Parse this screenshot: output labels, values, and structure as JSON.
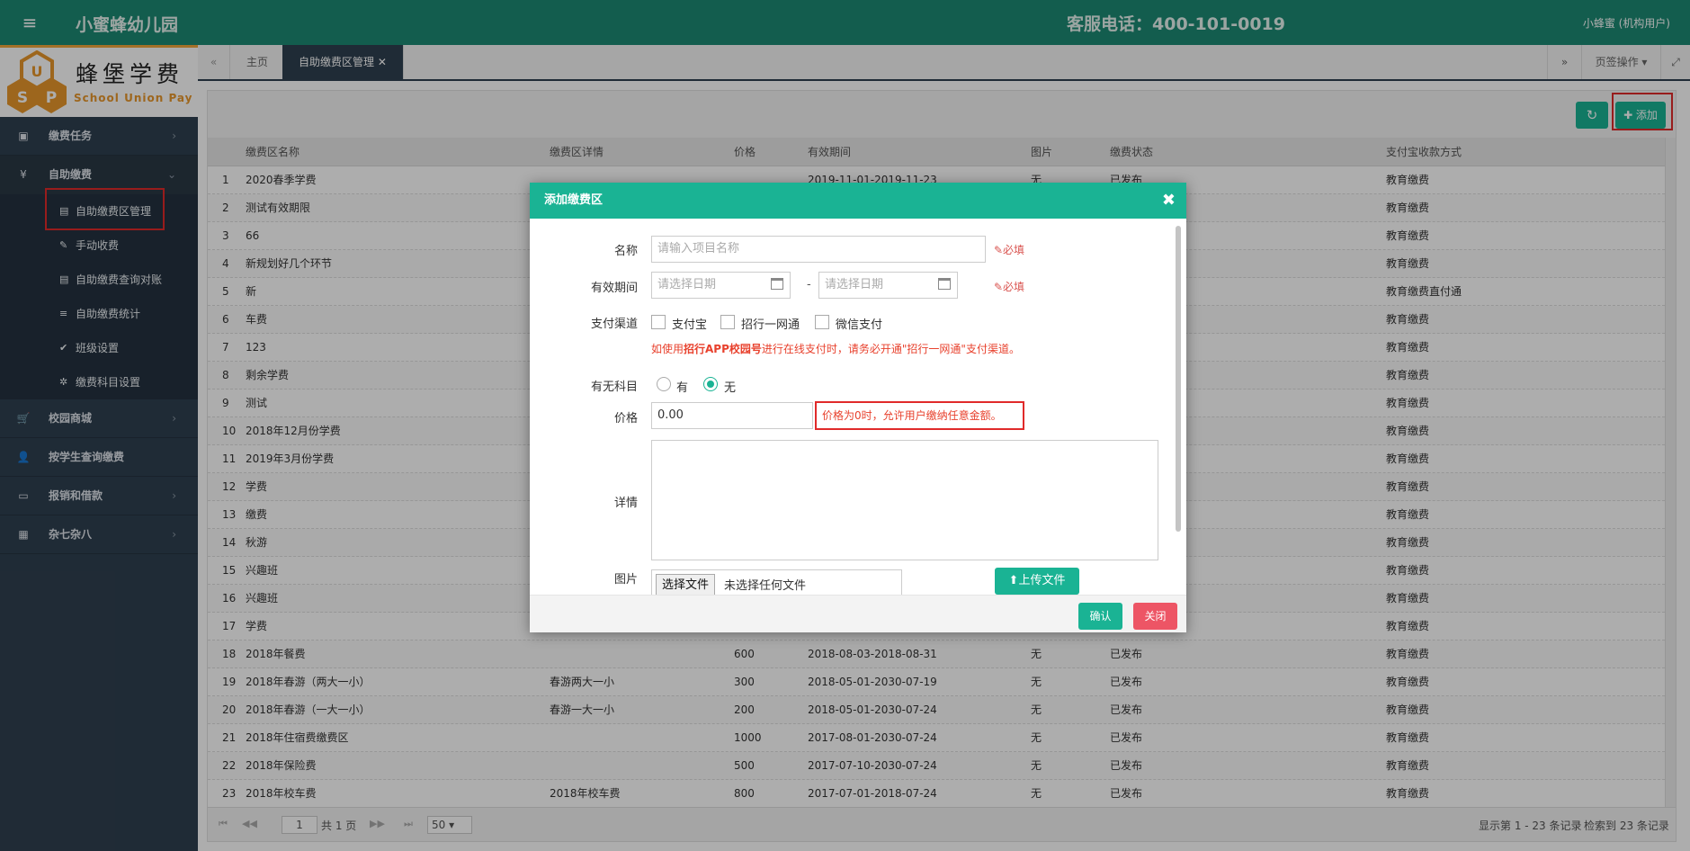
{
  "header": {
    "menu_icon": "≡",
    "app_title": "小蜜蜂幼儿园",
    "hotline": "客服电话：400-101-0019",
    "user": "小蜂蜜 (机构用户)",
    "bg_color": "#1c8a74"
  },
  "logo": {
    "brand": "蜂堡学费",
    "brand_en": "School Union Pay",
    "mark_letters": [
      "U",
      "S",
      "P"
    ]
  },
  "sidebar": {
    "items": [
      {
        "label": "缴费任务",
        "icon": "money-icon",
        "glyph": "▣",
        "arrow": "›"
      },
      {
        "label": "自助缴费",
        "icon": "yen-icon",
        "glyph": "¥",
        "arrow": "⌄"
      },
      {
        "label": "校园商城",
        "icon": "cart-icon",
        "glyph": "🛒",
        "arrow": "›"
      },
      {
        "label": "按学生查询缴费",
        "icon": "user-icon",
        "glyph": "👤",
        "arrow": ""
      },
      {
        "label": "报销和借款",
        "icon": "card-icon",
        "glyph": "▭",
        "arrow": "›"
      },
      {
        "label": "杂七杂八",
        "icon": "grid-icon",
        "glyph": "▦",
        "arrow": "›"
      }
    ],
    "sub_items": [
      {
        "label": "自助缴费区管理",
        "glyph": "▤"
      },
      {
        "label": "手动收费",
        "glyph": "✎"
      },
      {
        "label": "自助缴费查询对账",
        "glyph": "▤"
      },
      {
        "label": "自助缴费统计",
        "glyph": "≡"
      },
      {
        "label": "班级设置",
        "glyph": "✔"
      },
      {
        "label": "缴费科目设置",
        "glyph": "✲"
      }
    ]
  },
  "tabs": {
    "back": "«",
    "home": "主页",
    "active": "自助缴费区管理 ✕",
    "forward": "»",
    "page_ops": "页签操作 ▾",
    "fullscreen": "⤢"
  },
  "toolbar": {
    "refresh": "↻",
    "add": "✚ 添加"
  },
  "table": {
    "headers": [
      "缴费区名称",
      "缴费区详情",
      "价格",
      "有效期间",
      "图片",
      "缴费状态",
      "支付宝收款方式"
    ],
    "rows": [
      [
        "1",
        "2020春季学费",
        "",
        "",
        "2019-11-01-2019-11-23",
        "无",
        "已发布",
        "教育缴费"
      ],
      [
        "2",
        "测试有效期限",
        "",
        "",
        "",
        "",
        "",
        "教育缴费"
      ],
      [
        "3",
        "66",
        "",
        "",
        "",
        "",
        "",
        "教育缴费"
      ],
      [
        "4",
        "新规划好几个环节",
        "",
        "",
        "",
        "",
        "",
        "教育缴费"
      ],
      [
        "5",
        "新",
        "",
        "",
        "",
        "",
        "",
        "教育缴费直付通"
      ],
      [
        "6",
        "车费",
        "",
        "",
        "",
        "",
        "",
        "教育缴费"
      ],
      [
        "7",
        "123",
        "",
        "",
        "",
        "",
        "",
        "教育缴费"
      ],
      [
        "8",
        "剩余学费",
        "",
        "",
        "",
        "",
        "",
        "教育缴费"
      ],
      [
        "9",
        "测试",
        "",
        "",
        "",
        "",
        "",
        "教育缴费"
      ],
      [
        "10",
        "2018年12月份学费",
        "",
        "",
        "",
        "",
        "",
        "教育缴费"
      ],
      [
        "11",
        "2019年3月份学费",
        "",
        "",
        "",
        "",
        "",
        "教育缴费"
      ],
      [
        "12",
        "学费",
        "",
        "",
        "",
        "",
        "",
        "教育缴费"
      ],
      [
        "13",
        "缴费",
        "",
        "",
        "",
        "",
        "",
        "教育缴费"
      ],
      [
        "14",
        "秋游",
        "",
        "",
        "",
        "",
        "",
        "教育缴费"
      ],
      [
        "15",
        "兴趣班",
        "",
        "",
        "",
        "",
        "",
        "教育缴费"
      ],
      [
        "16",
        "兴趣班",
        "",
        "",
        "",
        "",
        "",
        "教育缴费"
      ],
      [
        "17",
        "学费",
        "",
        "",
        "",
        "",
        "",
        "教育缴费"
      ],
      [
        "18",
        "2018年餐费",
        "",
        "600",
        "2018-08-03-2018-08-31",
        "无",
        "已发布",
        "教育缴费"
      ],
      [
        "19",
        "2018年春游（两大一小）",
        "春游两大一小",
        "300",
        "2018-05-01-2030-07-19",
        "无",
        "已发布",
        "教育缴费"
      ],
      [
        "20",
        "2018年春游（一大一小）",
        "春游一大一小",
        "200",
        "2018-05-01-2030-07-24",
        "无",
        "已发布",
        "教育缴费"
      ],
      [
        "21",
        "2018年住宿费缴费区",
        "",
        "1000",
        "2017-08-01-2030-07-24",
        "无",
        "已发布",
        "教育缴费"
      ],
      [
        "22",
        "2018年保险费",
        "",
        "500",
        "2017-07-10-2030-07-24",
        "无",
        "已发布",
        "教育缴费"
      ],
      [
        "23",
        "2018年校车费",
        "2018年校车费",
        "800",
        "2017-07-01-2018-07-24",
        "无",
        "已发布",
        "教育缴费"
      ]
    ]
  },
  "pager": {
    "first": "⏮",
    "prev": "◀◀",
    "next": "▶▶",
    "last": "⏭",
    "page": "1",
    "total_pages": "共 1 页",
    "page_size": "50 ▾",
    "showing": "显示第 1 - 23 条记录",
    "found": "检索到 23 条记录"
  },
  "modal": {
    "title": "添加缴费区",
    "close": "✖",
    "name_label": "名称",
    "name_placeholder": "请输入项目名称",
    "required": "✎必填",
    "period_label": "有效期间",
    "date_placeholder": "请选择日期",
    "dash": "-",
    "channel_label": "支付渠道",
    "channels": [
      "支付宝",
      "招行一网通",
      "微信支付"
    ],
    "channel_warning_pre": "如使用",
    "channel_warning_bold": "招行APP校园号",
    "channel_warning_post": "进行在线支付时，请务必开通\"招行一网通\"支付渠道。",
    "subject_label": "有无科目",
    "subject_options": [
      "有",
      "无"
    ],
    "subject_selected": "无",
    "price_label": "价格",
    "price_value": "0.00",
    "price_hint": "价格为0时，允许用户缴纳任意金额。",
    "detail_label": "详情",
    "image_label": "图片",
    "file_button": "选择文件",
    "file_status": "未选择任何文件",
    "upload": "⬆上传文件",
    "confirm": "确认",
    "cancel": "关闭"
  },
  "colors": {
    "accent": "#1ab394",
    "danger": "#ed5565",
    "sidebar": "#2f4050",
    "highlight": "#e02a2a"
  }
}
